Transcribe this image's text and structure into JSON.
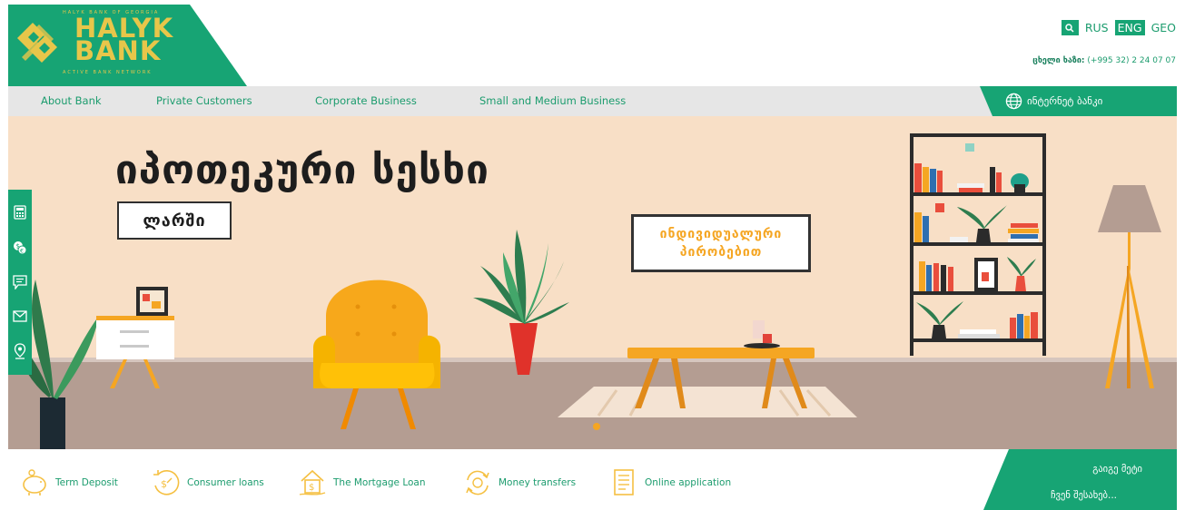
{
  "brand": {
    "name_line1": "HALYK",
    "name_line2": "BANK",
    "tagline_top": "HALYK BANK OF GEORGIA",
    "tagline_bottom": "ACTIVE BANK NETWORK",
    "color_primary": "#17a474",
    "color_gold": "#e7c64a"
  },
  "header": {
    "languages": [
      "RUS",
      "ENG",
      "GEO"
    ],
    "active_language": "ENG",
    "phone_label": "ცხელი ხაზი:",
    "phone_number": "(+995 32) 2 24 07 07"
  },
  "nav": {
    "items": [
      "About Bank",
      "Private Customers",
      "Corporate Business",
      "Small and Medium Business"
    ],
    "internet_bank": "ინტერნეტ ბანკი"
  },
  "hero": {
    "headline": "იპოთეკური სესხი",
    "currency_badge": "ლარში",
    "conditions_line1": "ინდივიდუალური",
    "conditions_line2": "პირობებით"
  },
  "side_toolbar": {
    "icons": [
      "calculator-icon",
      "currency-exchange-icon",
      "feedback-icon",
      "mail-icon",
      "location-pin-icon"
    ]
  },
  "bottom_bar": {
    "items": [
      {
        "label": "Term Deposit",
        "icon": "piggy-bank-icon"
      },
      {
        "label": "Consumer loans",
        "icon": "clock-money-icon"
      },
      {
        "label": "The Mortgage Loan",
        "icon": "house-money-icon"
      },
      {
        "label": "Money transfers",
        "icon": "transfer-icon"
      },
      {
        "label": "Online application",
        "icon": "form-document-icon"
      }
    ],
    "right_line1": "გაიგე მეტი",
    "right_line2": "ჩვენ შესახებ..."
  }
}
